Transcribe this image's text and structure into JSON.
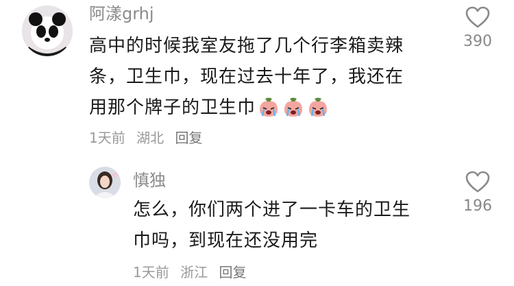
{
  "comments": [
    {
      "username": "阿漾grhj",
      "text_lines": [
        "高中的时候我室友拖了几个行李箱卖辣",
        "条，卫生巾，现在过去十年了，我还在",
        "用那个牌子的卫生巾"
      ],
      "emoji": "loudly-crying-face-emoji",
      "time": "1天前",
      "location": "湖北",
      "reply_label": "回复",
      "likes": "390"
    },
    {
      "username": "慎独",
      "text_lines": [
        "怎么，你们两个进了一卡车的卫生",
        "巾吗，到现在还没用完"
      ],
      "time": "1天前",
      "location": "浙江",
      "reply_label": "回复",
      "likes": "196"
    }
  ]
}
